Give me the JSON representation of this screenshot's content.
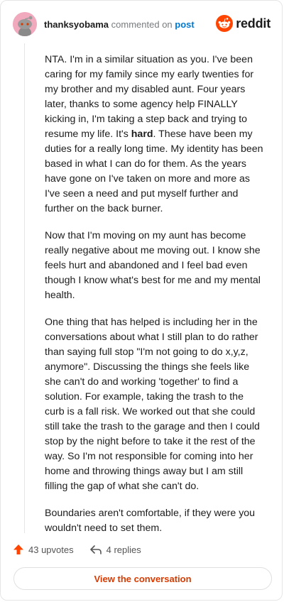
{
  "comment": {
    "username": "thanksyobama",
    "action_text": "commented on",
    "post_link": "post",
    "paragraphs": [
      [
        "NTA. I'm in a similar situation as you. I've been caring for my family since my early twenties for my brother and my disabled aunt. Four years later, thanks to some agency help FINALLY kicking in, I'm taking a step back and trying to resume my life. It's ",
        "hard",
        ". These have been my duties for a really long time. My identity has been based in what I can do for them. As the years have gone on I've taken on more and more as I've seen a need and put myself further and further on the back burner."
      ],
      "Now that I'm moving on my aunt has become really negative about me moving out. I know she feels hurt and abandoned and I feel bad even though I know what's best for me and my mental health.",
      "One thing that has helped is including her in the conversations about what I still plan to do rather than saying full stop \"I'm not going to do x,y,z, anymore\". Discussing the things she feels like she can't do and working 'together' to find a solution. For example, taking the trash to the curb is a fall risk. We worked out that she could still take the trash to the garage and then I could stop by the night before to take it the rest of the way. So I'm not responsible for coming into her home and throwing things away but I am still filling the gap of what she can't do.",
      "Boundaries aren't comfortable, if they were you wouldn't need to set them."
    ]
  },
  "brand": {
    "name": "reddit",
    "accent": "#ff4500"
  },
  "footer": {
    "upvotes": "43 upvotes",
    "replies": "4 replies",
    "view_button": "View the conversation"
  },
  "icons": {
    "avatar": "snoo-avatar-icon",
    "logo": "reddit-logo-icon",
    "upvote": "upvote-arrow-icon",
    "reply": "reply-arrow-icon"
  }
}
